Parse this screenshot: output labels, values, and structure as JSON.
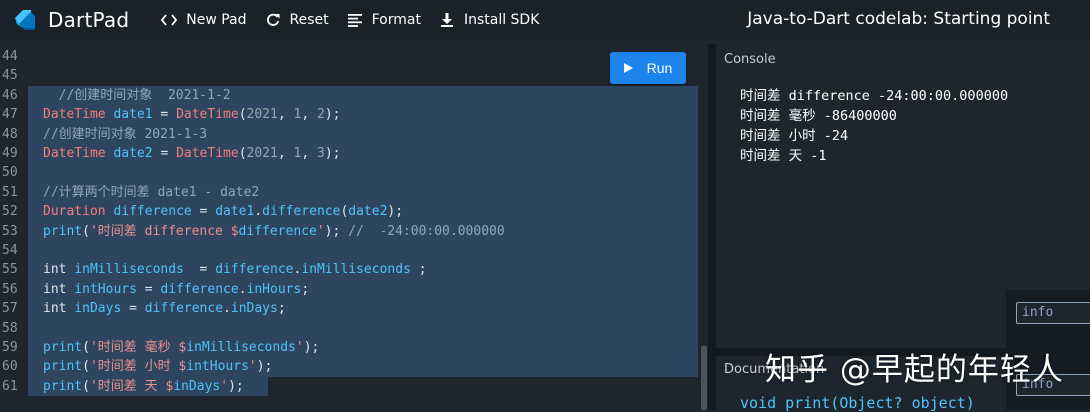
{
  "header": {
    "app_title": "DartPad",
    "buttons": [
      {
        "label": "New Pad",
        "icon": "code-brackets-icon"
      },
      {
        "label": "Reset",
        "icon": "refresh-icon"
      },
      {
        "label": "Format",
        "icon": "format-align-icon"
      },
      {
        "label": "Install SDK",
        "icon": "download-icon"
      }
    ],
    "codelab_title": "Java-to-Dart codelab: Starting point"
  },
  "editor": {
    "run_label": "Run",
    "line_numbers": [
      "44",
      "45",
      "46",
      "47",
      "48",
      "49",
      "50",
      "51",
      "52",
      "53",
      "54",
      "55",
      "56",
      "57",
      "58",
      "59",
      "60",
      "61"
    ],
    "selection_color": "#2e4560",
    "lines": [
      {
        "n": "44",
        "text": ""
      },
      {
        "n": "45",
        "text": ""
      },
      {
        "n": "46",
        "text": "  //创建时间对象  2021-1-2"
      },
      {
        "n": "47",
        "text": "DateTime date1 = DateTime(2021, 1, 2);"
      },
      {
        "n": "48",
        "text": "//创建时间对象 2021-1-3"
      },
      {
        "n": "49",
        "text": "DateTime date2 = DateTime(2021, 1, 3);"
      },
      {
        "n": "50",
        "text": ""
      },
      {
        "n": "51",
        "text": "//计算两个时间差 date1 - date2"
      },
      {
        "n": "52",
        "text": "Duration difference = date1.difference(date2);"
      },
      {
        "n": "53",
        "text": "print('时间差 difference $difference'); //  -24:00:00.000000"
      },
      {
        "n": "54",
        "text": ""
      },
      {
        "n": "55",
        "text": "int inMilliseconds  = difference.inMilliseconds ;"
      },
      {
        "n": "56",
        "text": "int intHours = difference.inHours;"
      },
      {
        "n": "57",
        "text": "int inDays = difference.inDays;"
      },
      {
        "n": "58",
        "text": ""
      },
      {
        "n": "59",
        "text": "print('时间差 毫秒 $inMilliseconds');"
      },
      {
        "n": "60",
        "text": "print('时间差 小时 $intHours');"
      },
      {
        "n": "61",
        "text": "print('时间差 天 $inDays');"
      }
    ],
    "tokens": {
      "l46": "  //创建时间对象  2021-1-2",
      "l47": [
        "DateTime",
        " date1",
        " = ",
        "DateTime",
        "(",
        "2021",
        ", ",
        "1",
        ", ",
        "2",
        ");"
      ],
      "l48": "//创建时间对象 2021-1-3",
      "l49": [
        "DateTime",
        " date2",
        " = ",
        "DateTime",
        "(",
        "2021",
        ", ",
        "1",
        ", ",
        "3",
        ");"
      ],
      "l51": "//计算两个时间差 date1 - date2",
      "l52": [
        "Duration",
        " difference",
        " = ",
        "date1",
        ".",
        "difference",
        "(",
        "date2",
        ");"
      ],
      "l53": [
        "print",
        "(",
        "'时间差 difference $",
        "difference",
        "'",
        ");",
        " //  -24:00:00.000000"
      ],
      "l55": [
        "int",
        " inMilliseconds",
        "  = ",
        "difference",
        ".",
        "inMilliseconds",
        " ;"
      ],
      "l56": [
        "int",
        " intHours",
        " = ",
        "difference",
        ".",
        "inHours",
        ";"
      ],
      "l57": [
        "int",
        " inDays",
        " = ",
        "difference",
        ".",
        "inDays",
        ";"
      ],
      "l59": [
        "print",
        "(",
        "'时间差 毫秒 $",
        "inMilliseconds",
        "'",
        ");"
      ],
      "l60": [
        "print",
        "(",
        "'时间差 小时 $",
        "intHours",
        "'",
        ");"
      ],
      "l61": [
        "print",
        "(",
        "'时间差 天 $",
        "inDays",
        "'",
        ");"
      ]
    }
  },
  "console": {
    "title": "Console",
    "output": [
      "时间差 difference -24:00:00.000000",
      "时间差 毫秒 -86400000",
      "时间差 小时 -24",
      "时间差 天 -1"
    ]
  },
  "documentation": {
    "title": "Documentation",
    "signature": "void print(Object? object)"
  },
  "issues": {
    "badges": [
      "info",
      "info"
    ]
  },
  "watermark": "知乎 @早起的年轻人",
  "colors": {
    "accent": "#1d84ec",
    "keyword": "#f47c7c",
    "identifier": "#4fc3f7",
    "comment": "#8fa6c1",
    "string": "#ec8f8f"
  }
}
